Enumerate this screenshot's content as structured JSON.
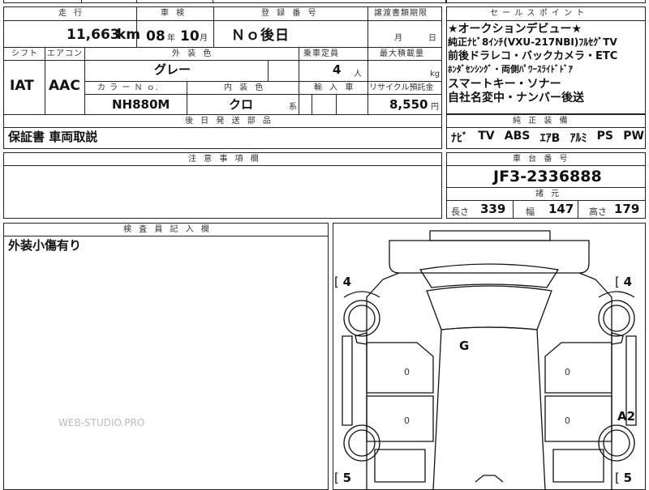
{
  "top_headers": {
    "mileage": "走 行",
    "shaken": "車 検",
    "registration": "登 録 番 号",
    "transfer_deadline": "譲渡書類期限",
    "sales_points": "セ ー ル ス ポ イ ン ト"
  },
  "mileage_value": "11,663",
  "mileage_unit": "km",
  "shaken_year": "08",
  "shaken_year_unit": "年",
  "shaken_month": "10",
  "shaken_month_unit": "月",
  "registration_value": "Ｎｏ後日",
  "transfer_month": "月",
  "transfer_day": "日",
  "second_headers": {
    "shift": "シフト",
    "aircon": "エアコン",
    "exterior_color": "外 装 色",
    "capacity": "乗車定員",
    "max_load": "最大積載量"
  },
  "shift_value": "IAT",
  "aircon_value": "AAC",
  "exterior_color_value": "グレー",
  "capacity_value": "4",
  "capacity_unit": "人",
  "max_load_unit": "kg",
  "third_headers": {
    "color_no": "カ ラ ー Ｎ ｏ.",
    "interior_color": "内 装 色",
    "import": "輸 入 車",
    "recycle": "リサイクル預託金"
  },
  "color_no_value": "NH880M",
  "interior_color_value": "クロ",
  "interior_suffix": "系",
  "recycle_value": "8,550",
  "recycle_unit": "円",
  "sales_points_lines": [
    "★オークションデビュー★",
    "純正ﾅﾋﾞ8ｲﾝﾁ(VXU-217NBI)ﾌﾙｾｸﾞTV",
    "前後ドラレコ・バックカメラ・ETC",
    "ﾎﾝﾀﾞｾﾝｼﾝｸﾞ・両側ﾊﾟﾜｰｽﾗｲﾄﾞﾄﾞｱ",
    "スマートキー・ソナー",
    "自社名変中・ナンバー後送"
  ],
  "later_parts_header": "後 日 発 送 部 品",
  "later_parts_value": "保証書 車両取説",
  "factory_equipment_header": "純 正 装 備",
  "factory_equipment": [
    "ﾅﾋﾞ",
    "TV",
    "ABS",
    "ｴｱB",
    "ｱﾙﾐ",
    "PS",
    "PW"
  ],
  "notes_header": "注 意 事 項 欄",
  "chassis_header": "車 台 番 号",
  "chassis_value": "JF3-2336888",
  "dimensions_header": "諸 元",
  "length_label": "長さ",
  "length_value": "339",
  "width_label": "幅",
  "width_value": "147",
  "height_label": "高さ",
  "height_value": "179",
  "inspector_header": "検 査 員 記 入 欄",
  "inspector_value": "外装小傷有り",
  "diagram": {
    "tire_fl": "4",
    "tire_fr": "4",
    "tire_rl": "5",
    "tire_rr": "5",
    "glass_mark": "G",
    "damage_mark": "A2",
    "door_marks": [
      "0",
      "0",
      "0",
      "0"
    ]
  },
  "watermark": "WEB-STUDIO.PRO"
}
